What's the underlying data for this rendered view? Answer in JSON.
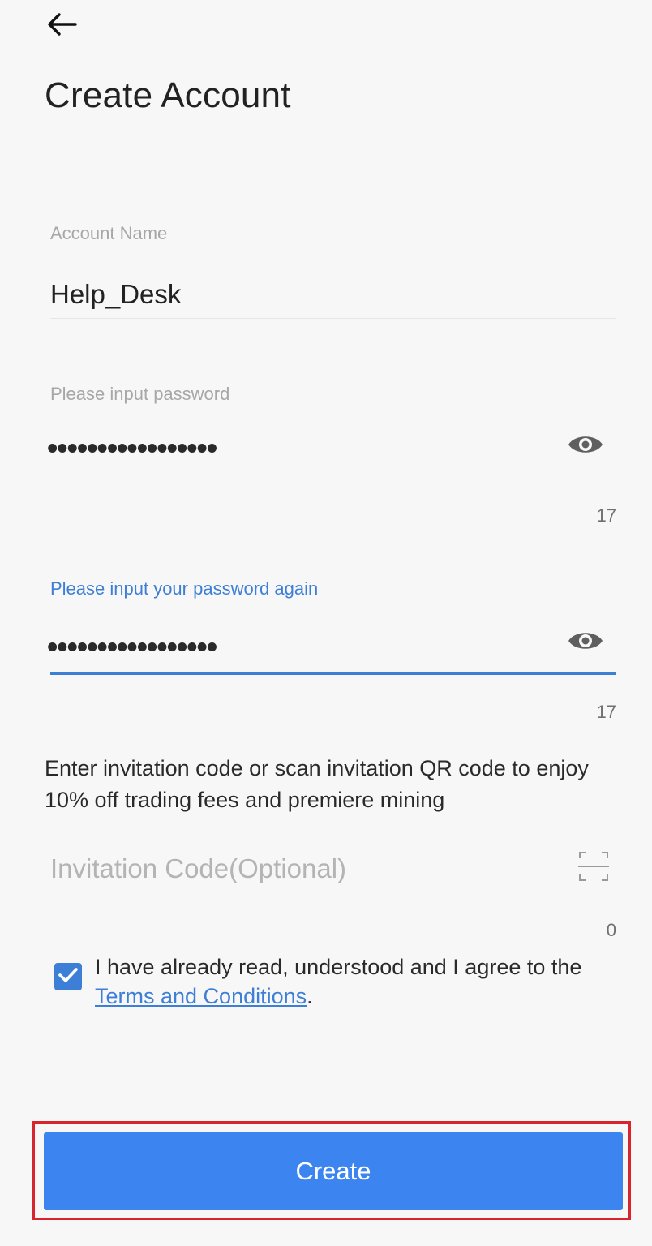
{
  "header": {
    "title": "Create Account",
    "back_icon": "arrow-left-icon"
  },
  "account_name": {
    "label": "Account Name",
    "value": "Help_Desk"
  },
  "password": {
    "label": "Please input password",
    "masked_value": "•••••••••••••••••",
    "char_count": "17",
    "toggle_icon": "eye-icon"
  },
  "confirm_password": {
    "label": "Please input your password again",
    "masked_value": "•••••••••••••••••",
    "char_count": "17",
    "toggle_icon": "eye-icon"
  },
  "invitation": {
    "description": "Enter invitation code or scan invitation QR code to enjoy 10% off trading fees and premiere mining",
    "placeholder": "Invitation Code(Optional)",
    "char_count": "0",
    "scan_icon": "scan-icon"
  },
  "agreement": {
    "checked": true,
    "text_before": "I have already read, understood and I agree to the ",
    "link_text": "Terms and Conditions",
    "text_after": "."
  },
  "actions": {
    "create_label": "Create"
  },
  "colors": {
    "accent": "#3d7fd6",
    "button": "#3c84f0",
    "highlight": "#d8242c",
    "background": "#f7f7f7"
  }
}
